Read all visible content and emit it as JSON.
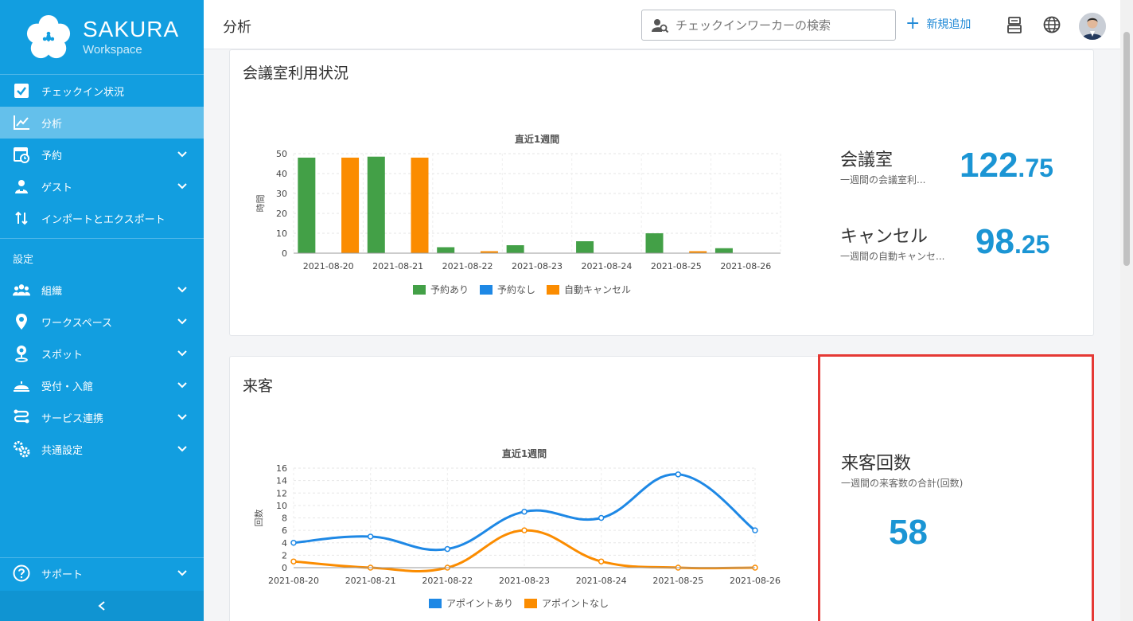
{
  "brand": {
    "name": "SAKURA",
    "sub": "Workspace"
  },
  "header": {
    "title": "分析",
    "search_placeholder": "チェックインワーカーの検索",
    "add_label": "新規追加"
  },
  "sidebar": {
    "items": [
      {
        "label": "チェックイン状況"
      },
      {
        "label": "分析"
      },
      {
        "label": "予約"
      },
      {
        "label": "ゲスト"
      },
      {
        "label": "インポートとエクスポート"
      }
    ],
    "section_label": "設定",
    "settings": [
      {
        "label": "組織"
      },
      {
        "label": "ワークスペース"
      },
      {
        "label": "スポット"
      },
      {
        "label": "受付・入館"
      },
      {
        "label": "サービス連携"
      },
      {
        "label": "共通設定"
      }
    ],
    "support_label": "サポート"
  },
  "meeting": {
    "title": "会議室利用状況",
    "stat1": {
      "name": "会議室",
      "desc": "一週間の会議室利...",
      "int": "122",
      "dec": ".75"
    },
    "stat2": {
      "name": "キャンセル",
      "desc": "一週間の自動キャンセ...",
      "int": "98",
      "dec": ".25"
    }
  },
  "visitors": {
    "title": "来客",
    "stat": {
      "name": "来客回数",
      "desc": "一週間の来客数の合計(回数)",
      "value": "58"
    }
  },
  "colors": {
    "green": "#43a047",
    "blue": "#1e88e5",
    "orange": "#fb8c00",
    "accent": "#1b95d4",
    "highlight": "#e53935"
  },
  "chart_data": [
    {
      "type": "bar",
      "title": "直近1週間",
      "ylabel": "時間",
      "categories": [
        "2021-08-20",
        "2021-08-21",
        "2021-08-22",
        "2021-08-23",
        "2021-08-24",
        "2021-08-25",
        "2021-08-26"
      ],
      "series": [
        {
          "name": "予約あり",
          "color": "#43a047",
          "values": [
            48,
            48.5,
            3,
            4,
            6,
            10,
            2.5
          ]
        },
        {
          "name": "予約なし",
          "color": "#1e88e5",
          "values": [
            0,
            0,
            0,
            0,
            0,
            0,
            0
          ]
        },
        {
          "name": "自動キャンセル",
          "color": "#fb8c00",
          "values": [
            48,
            48,
            1,
            0,
            0,
            1,
            0
          ]
        }
      ],
      "ylim": [
        0,
        50
      ],
      "yticks": [
        0,
        10,
        20,
        30,
        40,
        50
      ],
      "grid": true,
      "legend": "bottom"
    },
    {
      "type": "line",
      "title": "直近1週間",
      "ylabel": "回数",
      "categories": [
        "2021-08-20",
        "2021-08-21",
        "2021-08-22",
        "2021-08-23",
        "2021-08-24",
        "2021-08-25",
        "2021-08-26"
      ],
      "series": [
        {
          "name": "アポイントあり",
          "color": "#1e88e5",
          "values": [
            4,
            5,
            3,
            9,
            8,
            15,
            6
          ]
        },
        {
          "name": "アポイントなし",
          "color": "#fb8c00",
          "values": [
            1,
            0,
            0,
            6,
            1,
            0,
            0
          ]
        }
      ],
      "ylim": [
        0,
        16
      ],
      "yticks": [
        0,
        2,
        4,
        6,
        8,
        10,
        12,
        14,
        16
      ],
      "grid": true,
      "legend": "bottom"
    }
  ]
}
